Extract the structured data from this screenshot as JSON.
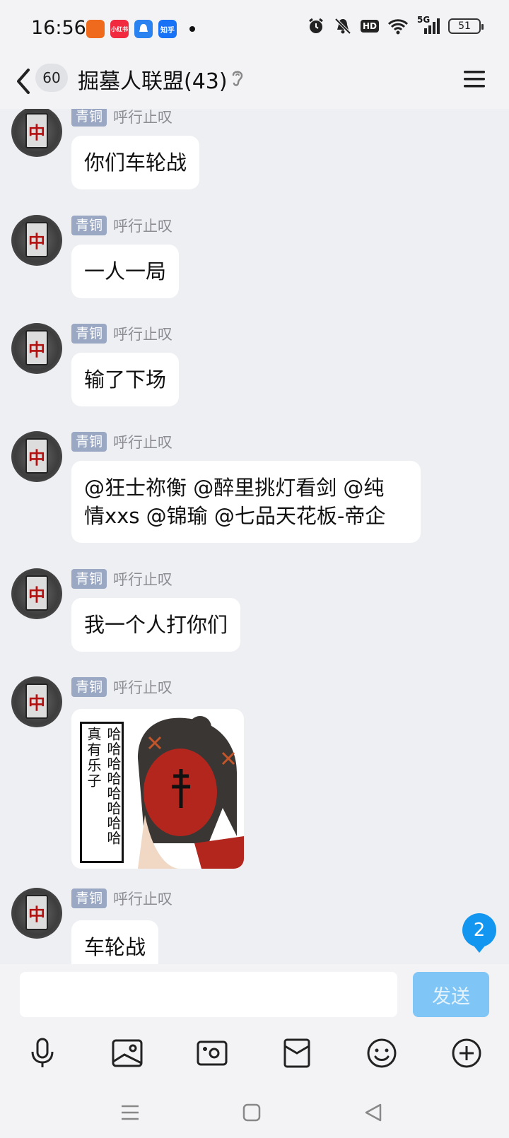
{
  "status_bar": {
    "time": "16:56",
    "apps": [
      {
        "name": "app-orange",
        "label": "",
        "color": "#f06a1e"
      },
      {
        "name": "app-xiaohongshu",
        "label": "小红书",
        "color": "#f12a3f"
      },
      {
        "name": "app-blue-bell",
        "label": "",
        "color": "#2a82f0"
      },
      {
        "name": "app-zhihu",
        "label": "知乎",
        "color": "#1772f6"
      }
    ],
    "hd_label": "HD",
    "network_label": "5G",
    "battery": "51"
  },
  "header": {
    "unread_count": "60",
    "title": "掘墓人联盟(43)"
  },
  "messages": [
    {
      "badge": "青铜",
      "nick": "呼行止叹",
      "text": "你们车轮战"
    },
    {
      "badge": "青铜",
      "nick": "呼行止叹",
      "text": "一人一局"
    },
    {
      "badge": "青铜",
      "nick": "呼行止叹",
      "text": "输了下场"
    },
    {
      "badge": "青铜",
      "nick": "呼行止叹",
      "line1": "@狂士祢衡 @醉里挑灯看剑 @纯",
      "line2": "情xxs @锦瑜 @七品天花板-帝企"
    },
    {
      "badge": "青铜",
      "nick": "呼行止叹",
      "text": "我一个人打你们"
    },
    {
      "badge": "青铜",
      "nick": "呼行止叹",
      "sticker_col1": "真有乐子",
      "sticker_col2": "哈哈哈哈哈哈哈哈"
    },
    {
      "badge": "青铜",
      "nick": "呼行止叹",
      "text": "车轮战"
    }
  ],
  "avatar_glyph": "中",
  "unread_float": "2",
  "input": {
    "placeholder": "",
    "send_label": "发送"
  },
  "colors": {
    "accent": "#1296f0",
    "send_disabled": "#7fc5f6",
    "badge_bg": "#9ba8c4",
    "chat_bg": "#eeeff3"
  }
}
